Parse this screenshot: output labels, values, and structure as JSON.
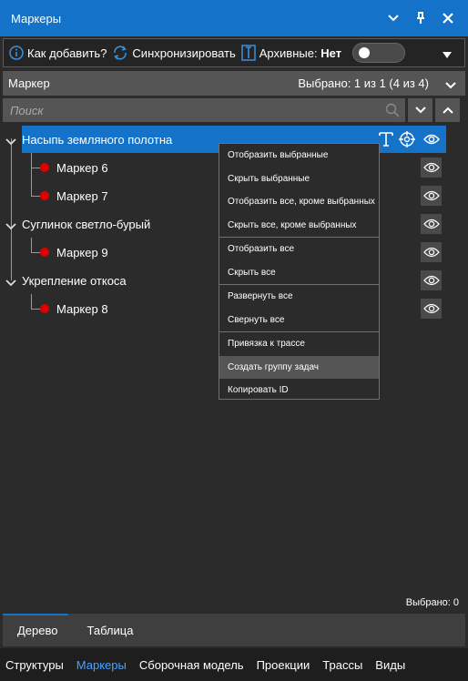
{
  "window": {
    "title": "Маркеры"
  },
  "toolbar": {
    "how_to_add": "Как добавить?",
    "sync": "Синхронизировать",
    "archive_label": "Архивные:",
    "archive_value": "Нет"
  },
  "list_header": {
    "title": "Маркер",
    "selected_count": "Выбрано: 1 из 1 (4 из 4)"
  },
  "search": {
    "placeholder": "Поиск"
  },
  "tree": {
    "group1": {
      "label": "Насыпь земляного полотна",
      "children": [
        "Маркер 6",
        "Маркер 7"
      ]
    },
    "group2": {
      "label": "Суглинок светло-бурый",
      "children": [
        "Маркер 9"
      ]
    },
    "group3": {
      "label": "Укрепление откоса",
      "children": [
        "Маркер 8"
      ]
    }
  },
  "context_menu": {
    "items": [
      "Отобразить выбранные",
      "Скрыть выбранные",
      "Отобразить все, кроме выбранных",
      "Скрыть все, кроме выбранных",
      "Отобразить все",
      "Скрыть все",
      "Развернуть все",
      "Свернуть все",
      "Привязка к трассе",
      "Создать группу задач",
      "Копировать ID"
    ],
    "highlighted": "Создать группу задач"
  },
  "status": {
    "selected": "Выбрано: 0"
  },
  "bottom_tabs": {
    "tree": "Дерево",
    "table": "Таблица"
  },
  "nav": {
    "items": [
      "Структуры",
      "Маркеры",
      "Сборочная модель",
      "Проекции",
      "Трассы",
      "Виды"
    ],
    "active": "Маркеры"
  },
  "colors": {
    "accent": "#1473c8",
    "marker": "#e00000",
    "panel": "#2b2b2b",
    "bar": "#555555"
  }
}
